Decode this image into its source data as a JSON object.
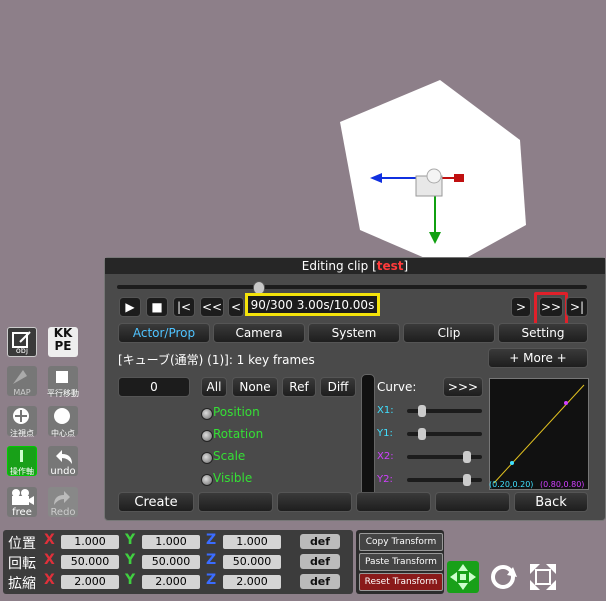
{
  "panel": {
    "title_prefix": "Editing clip [",
    "title_highlight": "test",
    "title_suffix": "]"
  },
  "timeline": {
    "position_fraction": 0.3,
    "time_display": "90/300 3.00s/10.00s"
  },
  "transport": {
    "play": "▶",
    "stop": "■",
    "first": "|<",
    "rewind": "<<",
    "prev": "<",
    "next": ">",
    "forward": ">>",
    "last": ">|"
  },
  "tabs": [
    "Actor/Prop",
    "Camera",
    "System",
    "Clip",
    "Setting"
  ],
  "clip_info": "[キューブ(通常)  (1)]: 1 key frames",
  "more_button": "+ More +",
  "frame_value": "0",
  "filter_buttons": [
    "All",
    "None",
    "Ref",
    "Diff"
  ],
  "properties": [
    "Position",
    "Rotation",
    "Scale",
    "Visible"
  ],
  "curve": {
    "label": "Curve:",
    "expand_button": ">>>",
    "params": [
      {
        "name": "X1:",
        "color": "cyan",
        "value": 0.2
      },
      {
        "name": "Y1:",
        "color": "cyan",
        "value": 0.2
      },
      {
        "name": "X2:",
        "color": "magenta",
        "value": 0.8
      },
      {
        "name": "Y2:",
        "color": "magenta",
        "value": 0.8
      }
    ],
    "point1_label": "(0.20,0.20)",
    "point2_label": "(0.80,0.80)"
  },
  "bottom_buttons": {
    "create": "Create",
    "back": "Back"
  },
  "sidebar": {
    "kkpe": "KK\nPE",
    "obj_caption": "obj",
    "map_caption": "MAP",
    "pan_caption": "平行移動",
    "gaze_caption": "注視点",
    "center_caption": "中心点",
    "axis_caption": "操作軸",
    "undo_caption": "undo",
    "free_caption": "free",
    "redo_caption": "Redo"
  },
  "transform": {
    "rows": [
      {
        "label": "位置",
        "x": "1.000",
        "y": "1.000",
        "z": "1.000"
      },
      {
        "label": "回転",
        "x": "50.000",
        "y": "50.000",
        "z": "50.000"
      },
      {
        "label": "拡縮",
        "x": "2.000",
        "y": "2.000",
        "z": "2.000"
      }
    ],
    "axis_x": "X",
    "axis_y": "Y",
    "axis_z": "Z",
    "def_label": "def",
    "copy_transform": "Copy Transform",
    "paste_transform": "Paste Transform",
    "reset_transform": "Reset Transform"
  },
  "colors": {
    "background": "#8d7f89",
    "highlight_yellow": "#f4e30a",
    "highlight_red": "#e0202a",
    "active_tab": "#4fc3ff",
    "property_green": "#35e035"
  }
}
